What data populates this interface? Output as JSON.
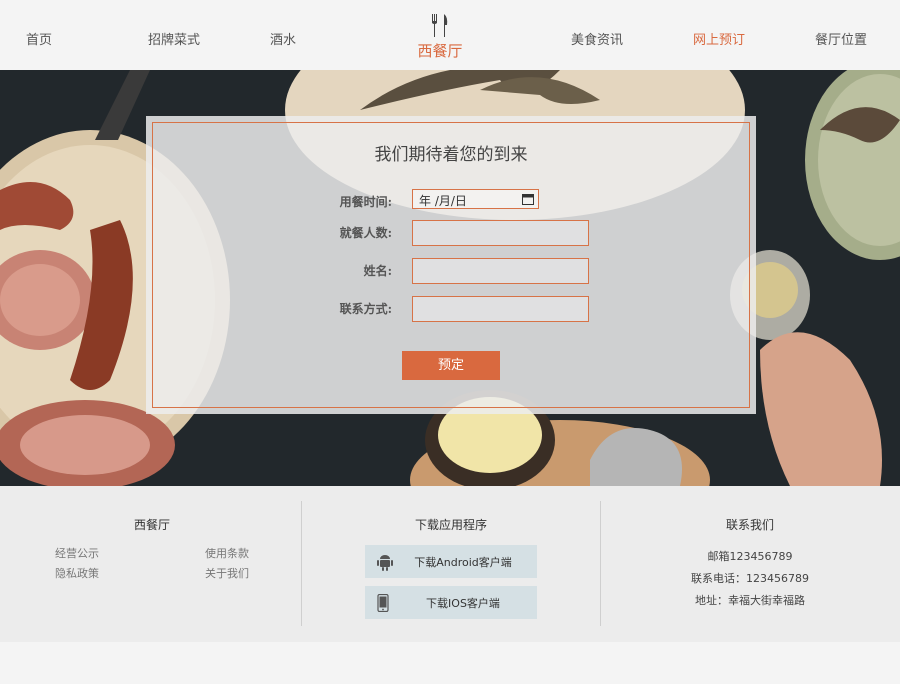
{
  "nav": {
    "home": "首页",
    "signature": "招牌菜式",
    "drinks": "酒水",
    "news": "美食资讯",
    "booking": "网上预订",
    "location": "餐厅位置"
  },
  "logo": {
    "text": "西餐厅",
    "icon": "fork-knife-icon"
  },
  "reservation": {
    "title": "我们期待着您的到来",
    "time_label": "用餐时间:",
    "date_placeholder": "年 /月/日",
    "people_label": "就餐人数:",
    "people_value": "",
    "name_label": "姓名:",
    "name_value": "",
    "contact_label": "联系方式:",
    "contact_value": "",
    "submit_label": "预定"
  },
  "footer": {
    "col1": {
      "title": "西餐厅",
      "links": [
        "经营公示",
        "使用条款",
        "隐私政策",
        "关于我们"
      ]
    },
    "col2": {
      "title": "下载应用程序",
      "android": "下载Android客户端",
      "ios": "下载IOS客户端"
    },
    "col3": {
      "title": "联系我们",
      "email": "邮箱123456789",
      "phone": "联系电话：123456789",
      "address": "地址：幸福大街幸福路"
    }
  },
  "colors": {
    "accent": "#d9693f",
    "button_bg": "#d5e0e4"
  }
}
